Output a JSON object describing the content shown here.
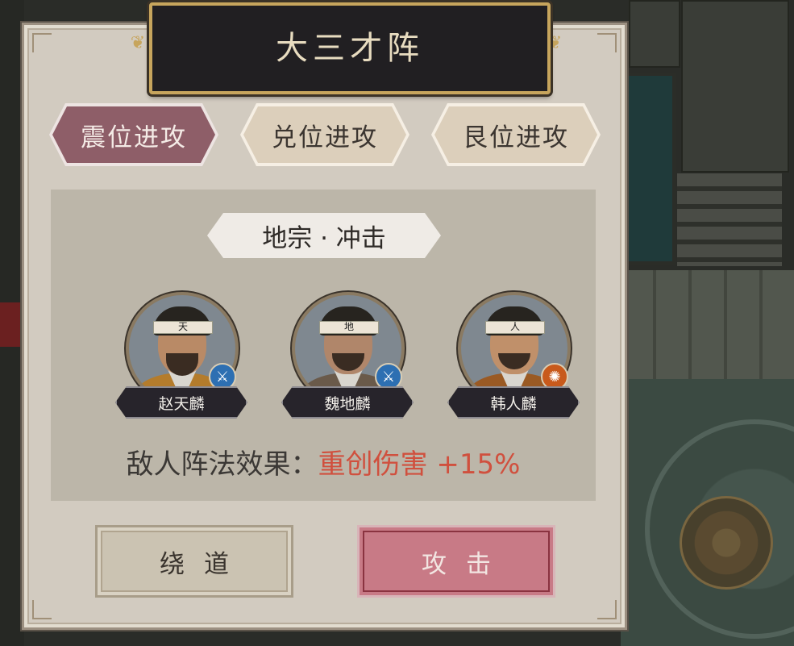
{
  "dialog": {
    "title": "大三才阵"
  },
  "tabs": [
    {
      "label": "震位进攻",
      "active": true
    },
    {
      "label": "兑位进攻",
      "active": false
    },
    {
      "label": "艮位进攻",
      "active": false
    }
  ],
  "formation": {
    "name": "地宗 · 冲击"
  },
  "heroes": [
    {
      "name": "赵天麟",
      "headband": "天",
      "badge_icon": "blue-weapon-icon"
    },
    {
      "name": "魏地麟",
      "headband": "地",
      "badge_icon": "blue-weapon-icon"
    },
    {
      "name": "韩人麟",
      "headband": "人",
      "badge_icon": "orange-emblem-icon"
    }
  ],
  "effect": {
    "label": "敌人阵法效果：",
    "value": "重创伤害 +15%"
  },
  "buttons": {
    "detour": "绕道",
    "attack": "攻击"
  },
  "colors": {
    "active_tab": "#8e5e68",
    "effect_value": "#d0503e",
    "attack_button": "#c87a86"
  }
}
